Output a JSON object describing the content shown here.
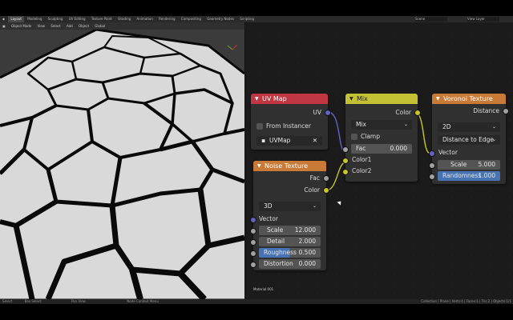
{
  "topbar": {
    "tabs": [
      "Layout",
      "Modeling",
      "Sculpting",
      "UV Editing",
      "Texture Paint",
      "Shading",
      "Animation",
      "Rendering",
      "Compositing",
      "Geometry Nodes",
      "Scripting"
    ],
    "scene": "Scene",
    "view_layer": "View Layer"
  },
  "viewport_header": {
    "mode": "Object Mode",
    "menus": [
      "View",
      "Select",
      "Add",
      "Object"
    ],
    "orientation": "Global"
  },
  "nodes": {
    "uvmap": {
      "title": "UV Map",
      "output": "UV",
      "from_instancer": "From Instancer",
      "map": "UVMap",
      "color": "#c13643"
    },
    "mix": {
      "title": "Mix",
      "output": "Color",
      "blend": "Mix",
      "clamp": "Clamp",
      "fac_label": "Fac",
      "fac_value": "0.000",
      "in1": "Color1",
      "in2": "Color2",
      "color": "#c5c134"
    },
    "voronoi": {
      "title": "Voronoi Texture",
      "output": "Distance",
      "dims": "2D",
      "feature": "Distance to Edge",
      "vector": "Vector",
      "scale_label": "Scale",
      "scale_value": "5.000",
      "rand_label": "Randomness",
      "rand_value": "1.000",
      "color": "#c87a36"
    },
    "noise": {
      "title": "Noise Texture",
      "out_fac": "Fac",
      "out_color": "Color",
      "dims": "3D",
      "vector": "Vector",
      "scale_label": "Scale",
      "scale_value": "12.000",
      "detail_label": "Detail",
      "detail_value": "2.000",
      "rough_label": "Roughness",
      "rough_value": "0.500",
      "dist_label": "Distortion",
      "dist_value": "0.000",
      "color": "#c87a36"
    }
  },
  "material_label": "Material.001",
  "statusbar": {
    "left": [
      "Select",
      "Box Select",
      "Pan View",
      "Node Context Menu"
    ],
    "right": "Collection | Plane | Verts:4 | Faces:1 | Tris:2 | Objects:1/1"
  }
}
